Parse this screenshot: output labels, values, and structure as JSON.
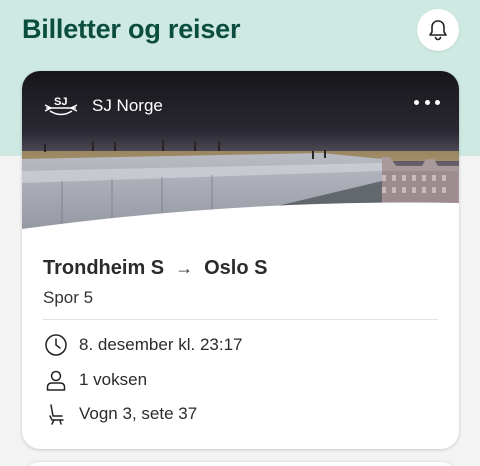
{
  "header": {
    "title": "Billetter og reiser",
    "notification_icon": "bell-icon"
  },
  "ticket": {
    "operator": "SJ Norge",
    "operator_logo": "sj-logo-icon",
    "menu_icon": "more-horizontal-icon",
    "from": "Trondheim S",
    "to": "Oslo S",
    "arrow_icon": "arrow-right-icon",
    "track": "Spor 5",
    "datetime": "8. desember kl. 23:17",
    "passengers": "1 voksen",
    "seat": "Vogn 3, sete 37",
    "icons": {
      "time": "clock-icon",
      "passengers": "person-icon",
      "seat": "seat-icon"
    }
  },
  "colors": {
    "header_band": "#cde9e2",
    "title": "#0b4d3f",
    "page_background": "#f3f3f3",
    "card": "#ffffff"
  }
}
